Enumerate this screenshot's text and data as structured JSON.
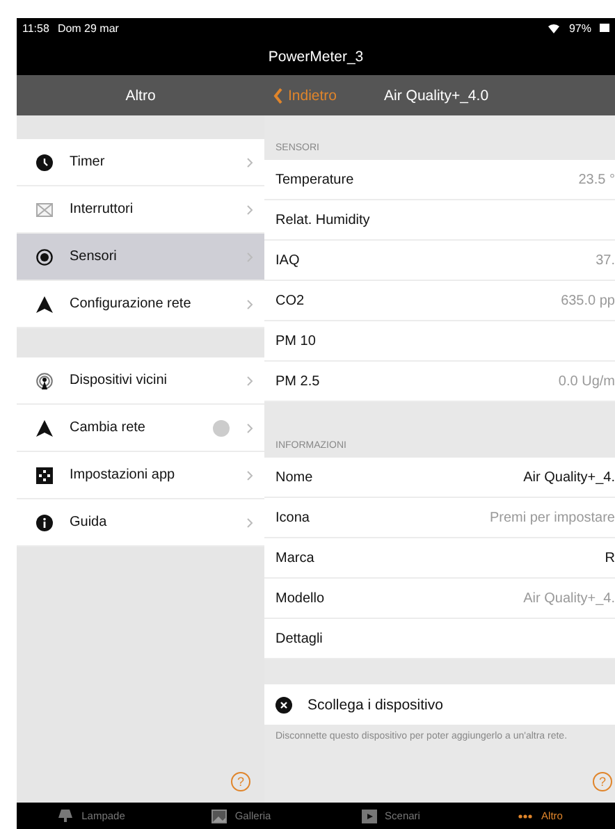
{
  "status_bar": {
    "time": "11:58",
    "date": "Dom 29 mar",
    "battery": "97%"
  },
  "title": "PowerMeter_3",
  "nav": {
    "left_title": "Altro",
    "back": "Indietro",
    "title": "Air Quality+_4.0"
  },
  "menu": {
    "groups": [
      [
        {
          "label": "Timer",
          "selected": false,
          "badge": false
        },
        {
          "label": "Interruttori",
          "selected": false,
          "badge": false
        },
        {
          "label": "Sensori",
          "selected": true,
          "badge": false
        },
        {
          "label": "Configurazione rete",
          "selected": false,
          "badge": false
        }
      ],
      [
        {
          "label": "Dispositivi vicini",
          "selected": false,
          "badge": false
        },
        {
          "label": "Cambia rete",
          "selected": false,
          "badge": true
        },
        {
          "label": "Impostazioni app",
          "selected": false,
          "badge": false
        },
        {
          "label": "Guida",
          "selected": false,
          "badge": false
        }
      ]
    ],
    "help": "?"
  },
  "sensors": {
    "header": "SENSORI",
    "rows": [
      {
        "label": "Temperature",
        "value": "23.5 °",
        "muted": true
      },
      {
        "label": "Relat. Humidity"
      },
      {
        "label": "IAQ",
        "value": "37.",
        "muted": true
      },
      {
        "label": "CO2",
        "value": "635.0 pp",
        "muted": true
      },
      {
        "label": "PM 10"
      },
      {
        "label": "PM 2.5",
        "value": "0.0 Ug/m",
        "muted": true
      }
    ]
  },
  "info": {
    "header": "INFORMAZIONI",
    "rows": [
      {
        "label": "Nome",
        "value": "Air Quality+_4.",
        "muted": false
      },
      {
        "label": "Icona",
        "value": "Premi per impostare",
        "muted": true
      },
      {
        "label": "Marca",
        "value": "R",
        "muted": false
      },
      {
        "label": "Modello",
        "value": "Air Quality+_4.",
        "muted": true
      },
      {
        "label": "Dettagli"
      }
    ]
  },
  "disconnect": {
    "label": "Scollega i dispositivo",
    "note": "Disconnette questo dispositivo per poter aggiungerlo a un'altra rete.",
    "help": "?"
  },
  "tabs": [
    {
      "label": "Lampade",
      "selected": false
    },
    {
      "label": "Galleria",
      "selected": false
    },
    {
      "label": "Scenari",
      "selected": false
    },
    {
      "label": "Altro",
      "selected": true
    }
  ]
}
